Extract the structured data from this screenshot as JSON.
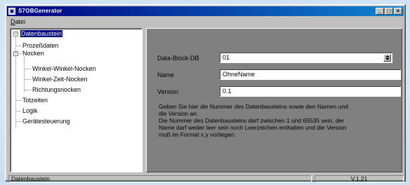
{
  "window": {
    "title": "S7OBGenerator",
    "controls": {
      "minimize": "_",
      "maximize": "□",
      "close": "×"
    }
  },
  "menu": {
    "items": [
      {
        "label": "Datei",
        "underline": "D",
        "rest": "atei"
      }
    ]
  },
  "tree": {
    "root": {
      "label": "Datenbaustein",
      "expander": "−",
      "selected": true
    },
    "items": [
      {
        "label": "Prozeßdaten"
      },
      {
        "label": "Nocken",
        "expander": "−"
      },
      {
        "label": "Winkel-Winkel-Nocken"
      },
      {
        "label": "Winkel-Zeit-Nocken"
      },
      {
        "label": "Richtungsnocken"
      },
      {
        "label": "Totzeiten"
      },
      {
        "label": "Logik"
      },
      {
        "label": "Gerätesteuerung"
      }
    ]
  },
  "form": {
    "fields": [
      {
        "label": "Data-Block-DB",
        "value": "01",
        "control": "spinner"
      },
      {
        "label": "Name",
        "value": "OhneName"
      },
      {
        "label": "Version",
        "value": "0.1"
      }
    ],
    "help": [
      "Geben Sie hier die Nummer des Datenbausteins sowie den Namen und",
      "die Version an.",
      "Die Nummer des Datenbausteins darf zwischen 1 und 65535 sein, der",
      "Name darf weder leer sein noch Leerzeichen enthalten und die Version",
      "muß im Format x.y vorliegen."
    ]
  },
  "status": {
    "left": "Datenbaustein",
    "right": "V.1.21"
  },
  "colors": {
    "title_start": "#000080",
    "title_end": "#1084d0",
    "panel": "#808080",
    "face": "#c0c0c0",
    "selection": "#000080"
  }
}
